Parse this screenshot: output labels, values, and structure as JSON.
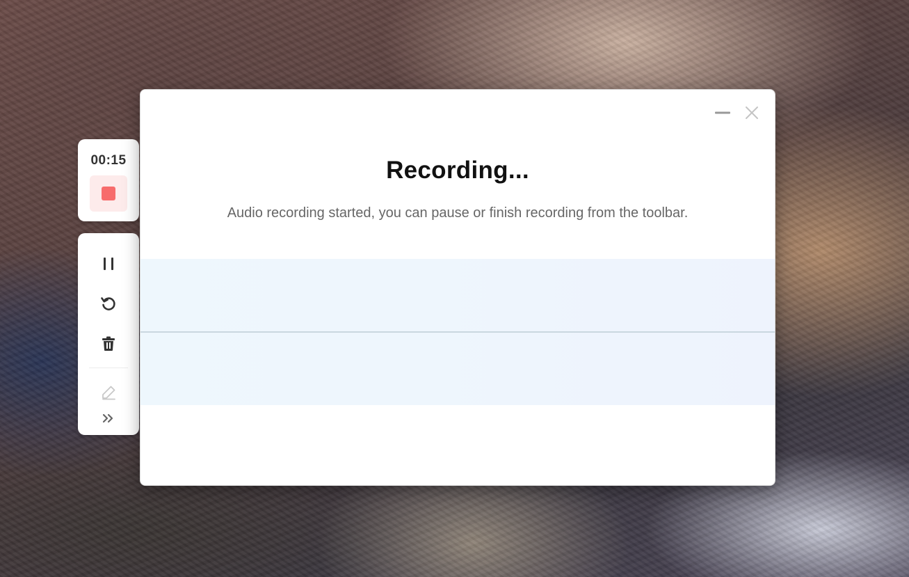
{
  "timer": {
    "elapsed": "00:15"
  },
  "toolbar": {
    "items": [
      {
        "name": "pause",
        "icon": "pause-icon"
      },
      {
        "name": "restart",
        "icon": "restart-icon"
      },
      {
        "name": "delete",
        "icon": "trash-icon"
      },
      {
        "name": "annotate",
        "icon": "pencil-icon",
        "enabled": false
      },
      {
        "name": "expand",
        "icon": "double-chevron-right-icon"
      }
    ]
  },
  "dialog": {
    "title": "Recording...",
    "description": "Audio recording started, you can pause or finish recording from the toolbar."
  },
  "colors": {
    "stop_red": "#f76c6c",
    "stop_bg": "#fdebeb",
    "wave_bg": "#eef6fd",
    "wave_line": "#c9d7df"
  }
}
